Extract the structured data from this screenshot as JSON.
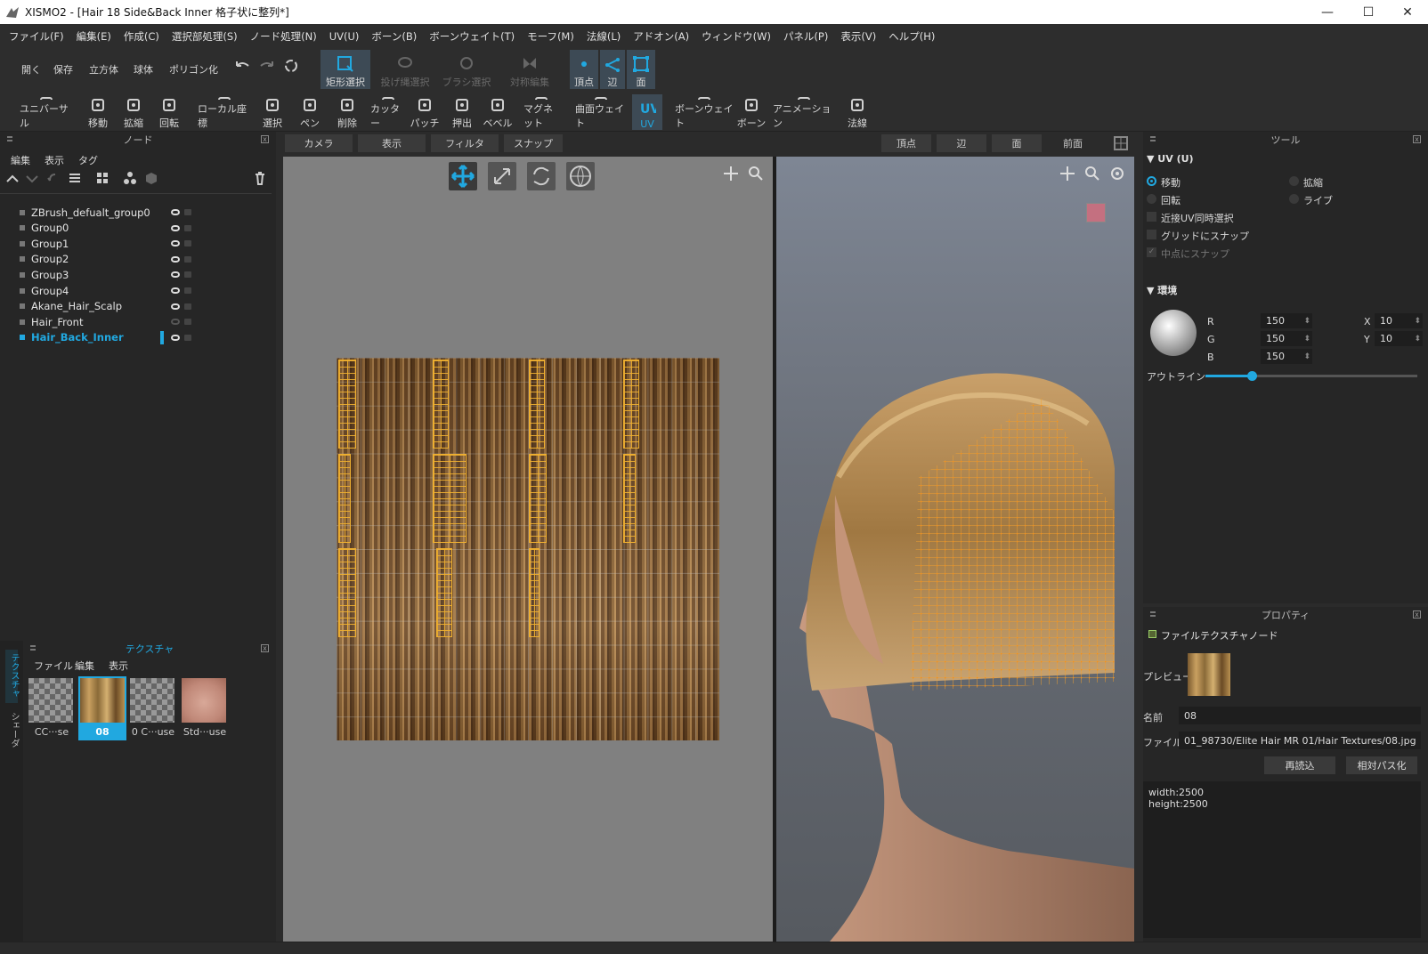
{
  "window": {
    "title": "XISMO2 - [Hair 18 Side&Back Inner 格子状に整列*]"
  },
  "menu": [
    "ファイル(F)",
    "編集(E)",
    "作成(C)",
    "選択部処理(S)",
    "ノード処理(N)",
    "UV(U)",
    "ボーン(B)",
    "ボーンウェイト(T)",
    "モーフ(M)",
    "法線(L)",
    "アドオン(A)",
    "ウィンドウ(W)",
    "パネル(P)",
    "表示(V)",
    "ヘルプ(H)"
  ],
  "toolbar1": {
    "open": "開く",
    "save": "保存",
    "cube": "立方体",
    "sphere": "球体",
    "polygon": "ポリゴン化",
    "rect_select": "矩形選択",
    "lasso_select": "投げ縄選択",
    "brush_select": "ブラシ選択",
    "sym_edit": "対称編集",
    "vertex": "頂点",
    "edge": "辺",
    "face": "面"
  },
  "toolbar2": [
    "ユニバーサル",
    "移動",
    "拡縮",
    "回転",
    "ローカル座標",
    "選択",
    "ペン",
    "削除",
    "カッター",
    "パッチ",
    "押出",
    "ベベル",
    "マグネット",
    "曲面ウェイト",
    "UV",
    "ボーンウェイト",
    "ボーン",
    "アニメーション",
    "法線"
  ],
  "node_panel": {
    "title": "ノード",
    "menu": [
      "編集",
      "表示",
      "タグ"
    ],
    "nodes": [
      "ZBrush_defualt_group0",
      "Group0",
      "Group1",
      "Group2",
      "Group3",
      "Group4",
      "Akane_Hair_Scalp",
      "Hair_Front",
      "Hair_Back_Inner"
    ]
  },
  "texture_panel": {
    "title": "テクスチャ",
    "menu": [
      "ファイル",
      "編集",
      "表示"
    ],
    "items": [
      "CC···se",
      "08",
      "0 C···use",
      "Std···use"
    ],
    "side_tabs": [
      "テクスチャ",
      "シェーダ"
    ]
  },
  "viewport_bar": {
    "left": [
      "カメラ",
      "表示",
      "フィルタ",
      "スナップ"
    ],
    "right": [
      "頂点",
      "辺",
      "面",
      "前面"
    ]
  },
  "tool_panel": {
    "title": "ツール",
    "uv_section": "UV (U)",
    "move": "移動",
    "scale": "拡縮",
    "rotate": "回転",
    "live": "ライブ",
    "near_uv": "近接UV同時選択",
    "grid_snap": "グリッドにスナップ",
    "mid_snap": "中点にスナップ",
    "env_section": "環境",
    "r_label": "R",
    "g_label": "G",
    "b_label": "B",
    "r": "150",
    "g": "150",
    "b": "150",
    "x_label": "X",
    "y_label": "Y",
    "x": "10",
    "y": "10",
    "outline": "アウトライン",
    "outline_value": 0.22
  },
  "property_panel": {
    "title": "プロパティ",
    "node_type": "ファイルテクスチャノード",
    "preview_label": "プレビュー",
    "name_label": "名前",
    "name": "08",
    "file_label": "ファイル",
    "file": "01_98730/Elite Hair MR 01/Hair Textures/08.jpg",
    "reload": "再読込",
    "relpath": "相対パス化",
    "info": [
      "width:2500",
      "height:2500"
    ]
  },
  "colors": {
    "accent": "#21a8e0",
    "uv_wire": "#f0b030",
    "viewport_bg": "#808080"
  }
}
